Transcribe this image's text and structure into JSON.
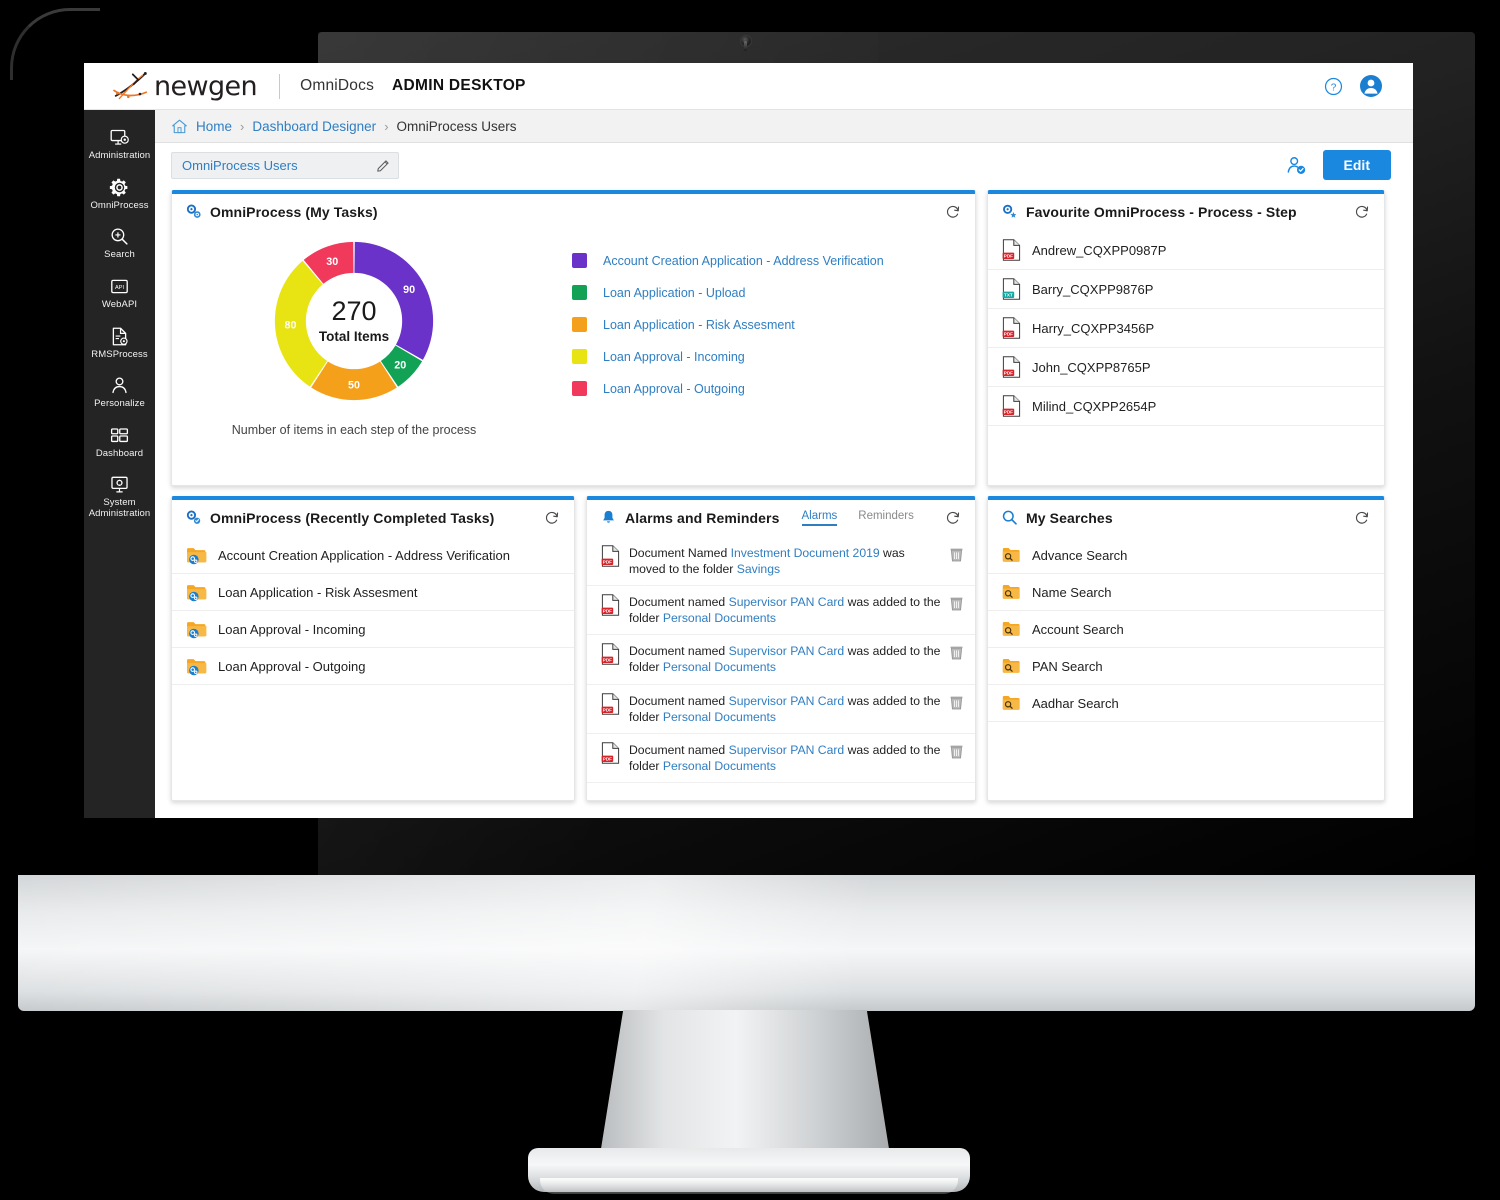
{
  "brand": {
    "logo_text": "newgen",
    "product": "OmniDocs",
    "desktop": "ADMIN DESKTOP",
    "help_icon": "help-circle-icon",
    "avatar_icon": "user-avatar-icon"
  },
  "sidebar": {
    "items": [
      {
        "label": "Administration",
        "icon": "monitor-gear-icon"
      },
      {
        "label": "OmniProcess",
        "icon": "gear-icon"
      },
      {
        "label": "Search",
        "icon": "search-plus-icon"
      },
      {
        "label": "WebAPI",
        "icon": "api-icon"
      },
      {
        "label": "RMSProcess",
        "icon": "document-gear-icon"
      },
      {
        "label": "Personalize",
        "icon": "person-icon"
      },
      {
        "label": "Dashboard",
        "icon": "grid-icon"
      },
      {
        "label": "System Administration",
        "icon": "system-monitor-icon"
      }
    ]
  },
  "breadcrumb": {
    "home_icon": "home-icon",
    "items": [
      "Home",
      "Dashboard Designer",
      "OmniProcess Users"
    ],
    "separator": "›"
  },
  "toolbar": {
    "dashboard_name": "OmniProcess Users",
    "edit_icon": "pencil-icon",
    "share_icon": "user-check-icon",
    "edit_label": "Edit"
  },
  "colors": {
    "accent": "#1b88e0",
    "link": "#2f7ec2",
    "sidebar_bg": "#242424"
  },
  "cards": {
    "my_tasks": {
      "title": "OmniProcess (My Tasks)",
      "icon": "gears-icon",
      "refresh_icon": "refresh-icon",
      "caption": "Number of items in each step of the process",
      "center_value": "270",
      "center_label": "Total Items"
    },
    "favourite": {
      "title": "Favourite OmniProcess - Process - Step",
      "icon": "gear-star-icon",
      "refresh_icon": "refresh-icon",
      "items": [
        {
          "label": "Andrew_CQXPP0987P",
          "icon": "pdf-file-icon",
          "type": "pdf"
        },
        {
          "label": "Barry_CQXPP9876P",
          "icon": "txt-file-icon",
          "type": "txt"
        },
        {
          "label": "Harry_CQXPP3456P",
          "icon": "pdf-file-icon",
          "type": "pdf"
        },
        {
          "label": "John_CQXPP8765P",
          "icon": "pdf-file-icon",
          "type": "pdf"
        },
        {
          "label": "Milind_CQXPP2654P",
          "icon": "pdf-file-icon",
          "type": "pdf"
        }
      ]
    },
    "completed": {
      "title": "OmniProcess (Recently Completed Tasks)",
      "icon": "gears-check-icon",
      "refresh_icon": "refresh-icon",
      "items": [
        {
          "label": "Account Creation Application - Address Verification",
          "icon": "folder-process-icon"
        },
        {
          "label": "Loan Application - Risk Assesment",
          "icon": "folder-process-icon"
        },
        {
          "label": "Loan Approval - Incoming",
          "icon": "folder-process-icon"
        },
        {
          "label": "Loan Approval - Outgoing",
          "icon": "folder-process-icon"
        }
      ]
    },
    "alarms": {
      "title": "Alarms and Reminders",
      "icon": "bell-icon",
      "refresh_icon": "refresh-icon",
      "tabs": [
        {
          "label": "Alarms",
          "active": true
        },
        {
          "label": "Reminders",
          "active": false
        }
      ],
      "items": [
        {
          "icon": "pdf-file-icon",
          "delete_icon": "trash-icon",
          "parts": [
            {
              "t": "Document Named ",
              "link": false
            },
            {
              "t": "Investment Document 2019",
              "link": true
            },
            {
              "t": " was moved to the folder ",
              "link": false
            },
            {
              "t": "Savings",
              "link": true
            }
          ]
        },
        {
          "icon": "pdf-file-icon",
          "delete_icon": "trash-icon",
          "parts": [
            {
              "t": "Document named ",
              "link": false
            },
            {
              "t": "Supervisor PAN Card",
              "link": true
            },
            {
              "t": " was added to the folder ",
              "link": false
            },
            {
              "t": "Personal Documents",
              "link": true
            }
          ]
        },
        {
          "icon": "pdf-file-icon",
          "delete_icon": "trash-icon",
          "parts": [
            {
              "t": "Document named ",
              "link": false
            },
            {
              "t": "Supervisor PAN Card",
              "link": true
            },
            {
              "t": " was added to the folder ",
              "link": false
            },
            {
              "t": "Personal Documents",
              "link": true
            }
          ]
        },
        {
          "icon": "pdf-file-icon",
          "delete_icon": "trash-icon",
          "parts": [
            {
              "t": "Document named ",
              "link": false
            },
            {
              "t": "Supervisor PAN Card",
              "link": true
            },
            {
              "t": " was added to the folder ",
              "link": false
            },
            {
              "t": "Personal Documents",
              "link": true
            }
          ]
        },
        {
          "icon": "pdf-file-icon",
          "delete_icon": "trash-icon",
          "parts": [
            {
              "t": "Document named ",
              "link": false
            },
            {
              "t": "Supervisor PAN Card",
              "link": true
            },
            {
              "t": " was added to the folder ",
              "link": false
            },
            {
              "t": "Personal Documents",
              "link": true
            }
          ]
        }
      ]
    },
    "searches": {
      "title": "My Searches",
      "icon": "search-icon",
      "refresh_icon": "refresh-icon",
      "items": [
        {
          "label": "Advance Search",
          "icon": "saved-search-icon"
        },
        {
          "label": "Name Search",
          "icon": "saved-search-icon"
        },
        {
          "label": "Account Search",
          "icon": "saved-search-icon"
        },
        {
          "label": "PAN Search",
          "icon": "saved-search-icon"
        },
        {
          "label": "Aadhar Search",
          "icon": "saved-search-icon"
        }
      ]
    }
  },
  "chart_data": {
    "type": "pie",
    "variant": "donut",
    "title": "OmniProcess (My Tasks)",
    "caption": "Number of items in each step of the process",
    "total": 270,
    "total_label": "Total Items",
    "start_angle": 0,
    "direction": "clockwise",
    "legend_position": "right",
    "categories": [
      "Account Creation Application - Address Verification",
      "Loan Application - Upload",
      "Loan Application - Risk Assesment",
      "Loan Approval - Incoming",
      "Loan Approval - Outgoing"
    ],
    "values": [
      90,
      20,
      50,
      80,
      30
    ],
    "colors": [
      "#6a32c9",
      "#12a256",
      "#f5a01b",
      "#e8e312",
      "#f0395b"
    ],
    "labels": [
      "90",
      "20",
      "50",
      "80",
      "30"
    ]
  }
}
